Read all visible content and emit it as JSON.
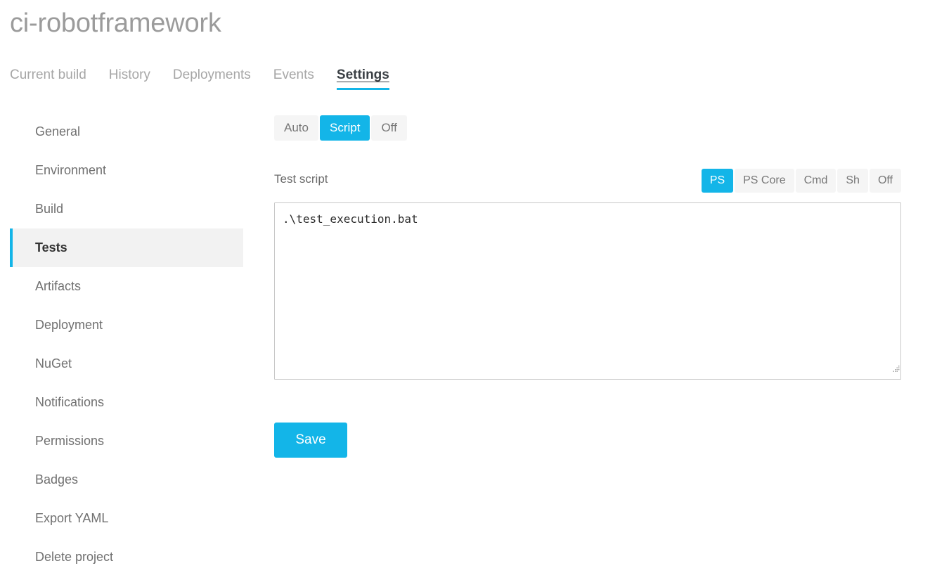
{
  "header": {
    "project_title": "ci-robotframework"
  },
  "tabs": [
    {
      "label": "Current build",
      "active": false
    },
    {
      "label": "History",
      "active": false
    },
    {
      "label": "Deployments",
      "active": false
    },
    {
      "label": "Events",
      "active": false
    },
    {
      "label": "Settings",
      "active": true
    }
  ],
  "sidebar": {
    "items": [
      {
        "label": "General",
        "active": false
      },
      {
        "label": "Environment",
        "active": false
      },
      {
        "label": "Build",
        "active": false
      },
      {
        "label": "Tests",
        "active": true
      },
      {
        "label": "Artifacts",
        "active": false
      },
      {
        "label": "Deployment",
        "active": false
      },
      {
        "label": "NuGet",
        "active": false
      },
      {
        "label": "Notifications",
        "active": false
      },
      {
        "label": "Permissions",
        "active": false
      },
      {
        "label": "Badges",
        "active": false
      },
      {
        "label": "Export YAML",
        "active": false
      },
      {
        "label": "Delete project",
        "active": false
      }
    ]
  },
  "main": {
    "test_mode": {
      "options": [
        {
          "label": "Auto",
          "active": false
        },
        {
          "label": "Script",
          "active": true
        },
        {
          "label": "Off",
          "active": false
        }
      ]
    },
    "test_script": {
      "label": "Test script",
      "shell_options": [
        {
          "label": "PS",
          "active": true
        },
        {
          "label": "PS Core",
          "active": false
        },
        {
          "label": "Cmd",
          "active": false
        },
        {
          "label": "Sh",
          "active": false
        },
        {
          "label": "Off",
          "active": false
        }
      ],
      "value": ".\\test_execution.bat",
      "placeholder": ""
    },
    "save_label": "Save"
  },
  "colors": {
    "accent": "#13b5e8",
    "active_nav_bg": "#f2f2f2",
    "segment_bg": "#f5f5f5",
    "muted_text": "#a6a6a6",
    "body_text": "#707070"
  }
}
